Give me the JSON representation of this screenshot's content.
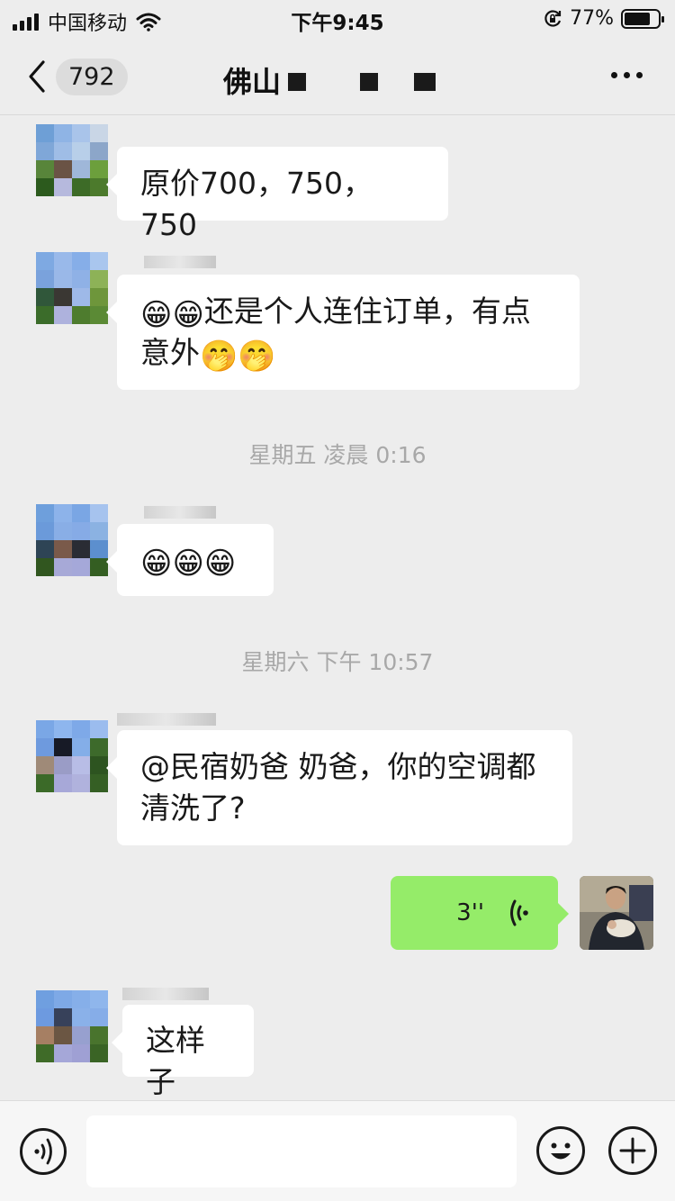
{
  "status_bar": {
    "carrier": "中国移动",
    "time": "下午9:45",
    "battery_percent": "77%",
    "battery_level": 0.77,
    "icons": [
      "signal-icon",
      "wifi-icon",
      "rotation-lock-icon",
      "battery-icon"
    ]
  },
  "nav": {
    "back_icon": "chevron-left-icon",
    "unread_count": "792",
    "title": "佛山",
    "more_icon": "more-dots-icon"
  },
  "messages": [
    {
      "type": "text",
      "side": "left",
      "text": "原价700，750，750"
    },
    {
      "type": "text",
      "side": "left",
      "emoji_lead": "😁😁",
      "text_main": "还是个人连住订单，有点意外",
      "emoji_tail": "🤭🤭"
    },
    {
      "type": "timestamp",
      "text": "星期五 凌晨 0:16"
    },
    {
      "type": "text",
      "side": "left",
      "emoji_lead": "😁😁😁"
    },
    {
      "type": "timestamp",
      "text": "星期六 下午 10:57"
    },
    {
      "type": "text",
      "side": "left",
      "text": "@民宿奶爸 奶爸，你的空调都清洗了?"
    },
    {
      "type": "voice",
      "side": "right",
      "duration": "3''",
      "icon": "voice-wave-icon"
    },
    {
      "type": "text",
      "side": "left",
      "text": "这样子"
    }
  ],
  "input_bar": {
    "voice_icon": "voice-toggle-icon",
    "input_value": "",
    "emoji_icon": "emoji-icon",
    "plus_icon": "plus-icon"
  }
}
